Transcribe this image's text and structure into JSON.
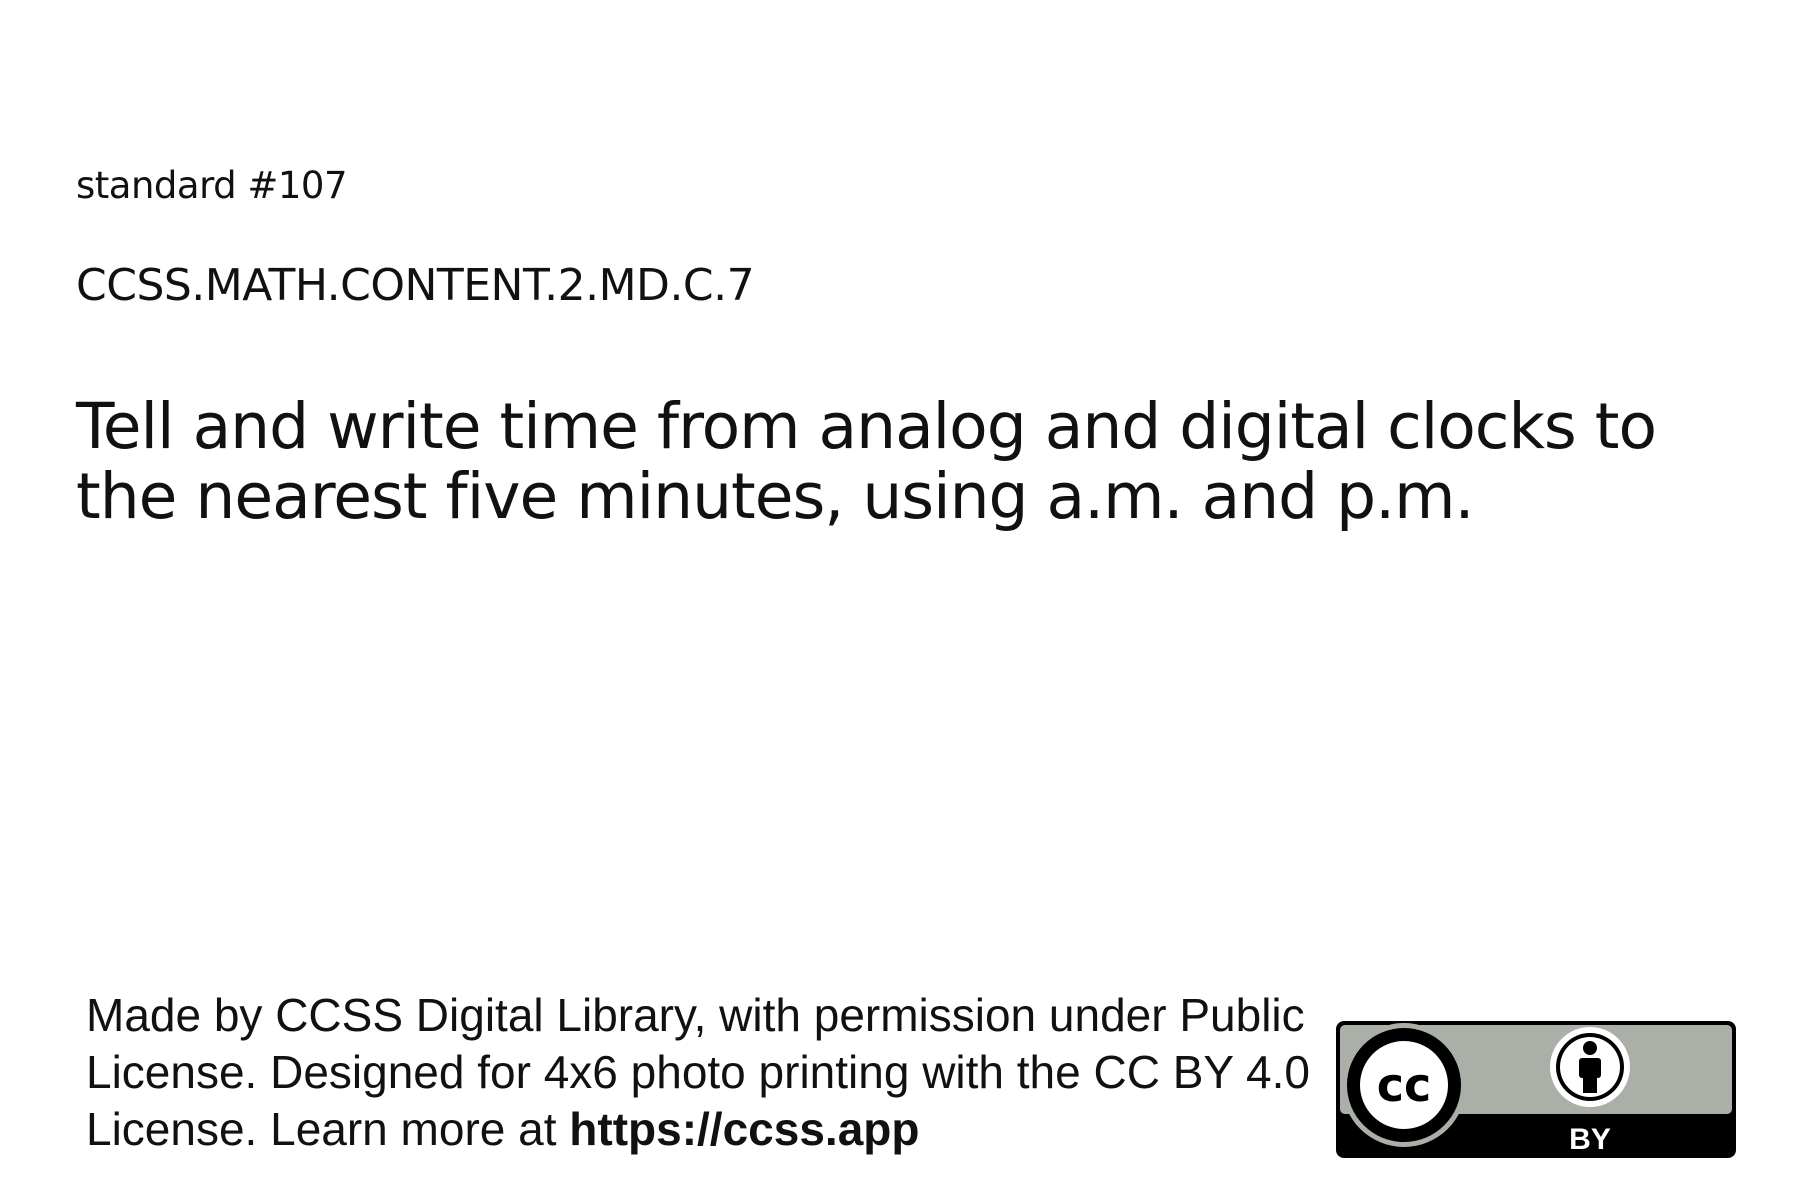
{
  "card": {
    "standard_number": "standard #107",
    "standard_code": "CCSS.MATH.CONTENT.2.MD.C.7",
    "standard_text": "Tell and write time from analog and digital clocks to the nearest five minutes, using a.m. and p.m."
  },
  "footer": {
    "credit_text": "Made by CCSS Digital Library, with permission under Public License. Designed for 4x6 photo printing with the CC BY 4.0 License. Learn more at ",
    "credit_url": "https://ccss.app",
    "license_badge": {
      "cc_label": "cc",
      "by_label": "BY",
      "colors": {
        "top_band": "#aab0a8",
        "bottom_band": "#000000",
        "ring": "#000000",
        "inner": "#ffffff"
      }
    }
  }
}
